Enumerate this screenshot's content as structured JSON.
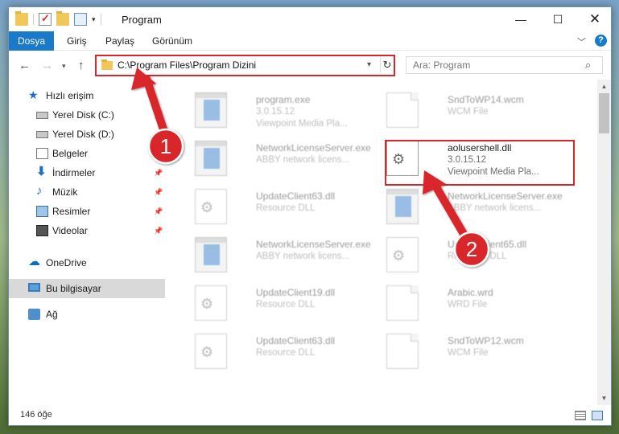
{
  "window": {
    "title": "Program",
    "controls": {
      "minimize": "—",
      "maximize": "☐",
      "close": "✕"
    }
  },
  "ribbon": {
    "tabs": [
      "Dosya",
      "Giriş",
      "Paylaş",
      "Görünüm"
    ],
    "help": "?"
  },
  "navigation": {
    "back": "←",
    "forward": "→",
    "recent": "▾",
    "up": "↑",
    "address": "C:\\Program Files\\Program Dizini",
    "address_dropdown": "▾",
    "refresh": "↻",
    "search_placeholder": "Ara: Program",
    "search_icon": "⌕"
  },
  "sidebar": {
    "items": [
      {
        "label": "Hızlı erişim",
        "icon": "star-icon",
        "pinned": false
      },
      {
        "label": "Yerel Disk (C:)",
        "icon": "disk-icon",
        "pinned": true
      },
      {
        "label": "Yerel Disk (D:)",
        "icon": "disk-icon",
        "pinned": true
      },
      {
        "label": "Belgeler",
        "icon": "documents-icon",
        "pinned": true
      },
      {
        "label": "İndirmeler",
        "icon": "download-icon",
        "pinned": true
      },
      {
        "label": "Müzik",
        "icon": "music-icon",
        "pinned": true
      },
      {
        "label": "Resimler",
        "icon": "pictures-icon",
        "pinned": true
      },
      {
        "label": "Videolar",
        "icon": "videos-icon",
        "pinned": true
      },
      {
        "label": "OneDrive",
        "icon": "cloud-icon",
        "pinned": false
      },
      {
        "label": "Bu bilgisayar",
        "icon": "computer-icon",
        "pinned": false,
        "selected": true
      },
      {
        "label": "Ağ",
        "icon": "network-icon",
        "pinned": false
      }
    ],
    "pin_glyph": "📌"
  },
  "files": [
    {
      "name": "program.exe",
      "line2": "3.0.15.12",
      "line3": "Viewpoint Media Pla...",
      "icon": "exe-icon",
      "faded": true
    },
    {
      "name": "SndToWP14.wcm",
      "line2": "WCM File",
      "line3": "",
      "icon": "document-icon",
      "faded": true
    },
    {
      "name": "NetworkLicenseServer.exe",
      "line2": "ABBY network licens...",
      "line3": "",
      "icon": "exe-icon",
      "faded": true
    },
    {
      "name": "aolusershell.dll",
      "line2": "3.0.15.12",
      "line3": "Viewpoint Media Pla...",
      "icon": "gear-document-icon",
      "faded": false
    },
    {
      "name": "UpdateClient63.dll",
      "line2": "Resource DLL",
      "line3": "",
      "icon": "gear-document-icon",
      "faded": true
    },
    {
      "name": "NetworkLicenseServer.exe",
      "line2": "ABBY network licens...",
      "line3": "",
      "icon": "exe-icon",
      "faded": true
    },
    {
      "name": "NetworkLicenseServer.exe",
      "line2": "ABBY network licens...",
      "line3": "",
      "icon": "exe-icon",
      "faded": true
    },
    {
      "name": "UpdateClient65.dll",
      "line2": "Resource DLL",
      "line3": "",
      "icon": "gear-document-icon",
      "faded": true
    },
    {
      "name": "UpdateClient19.dll",
      "line2": "Resource DLL",
      "line3": "",
      "icon": "gear-document-icon",
      "faded": true
    },
    {
      "name": "Arabic.wrd",
      "line2": "WRD File",
      "line3": "",
      "icon": "document-icon",
      "faded": true
    },
    {
      "name": "UpdateClient63.dll",
      "line2": "Resource DLL",
      "line3": "",
      "icon": "gear-document-icon",
      "faded": true
    },
    {
      "name": "SndToWP12.wcm",
      "line2": "WCM File",
      "line3": "",
      "icon": "document-icon",
      "faded": true
    }
  ],
  "status": {
    "item_count": "146 öğe"
  },
  "annotations": {
    "step1": "1",
    "step2": "2",
    "color": "#d9262c"
  },
  "colors": {
    "accent": "#1979ca",
    "highlight": "#d9262c"
  }
}
